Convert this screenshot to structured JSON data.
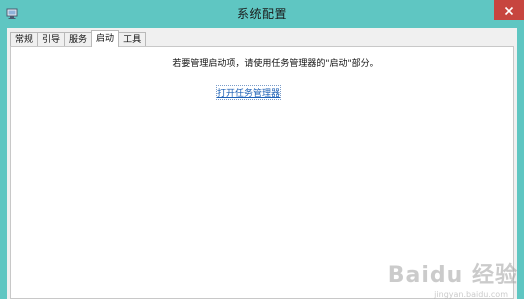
{
  "window": {
    "title": "系统配置"
  },
  "tabs": [
    {
      "label": "常规",
      "active": false
    },
    {
      "label": "引导",
      "active": false
    },
    {
      "label": "服务",
      "active": false
    },
    {
      "label": "启动",
      "active": true
    },
    {
      "label": "工具",
      "active": false
    }
  ],
  "startup_panel": {
    "info_text": "若要管理启动项，请使用任务管理器的\"启动\"部分。",
    "link_label": "打开任务管理器"
  },
  "watermark": {
    "text": "Baidu 经验",
    "subtext": "jingyan.baidu.com"
  },
  "colors": {
    "titlebar": "#5fc6c2",
    "close_button": "#c7453f",
    "link": "#1b5fb5"
  },
  "icons": {
    "app": "msconfig-icon",
    "close": "close-icon"
  }
}
